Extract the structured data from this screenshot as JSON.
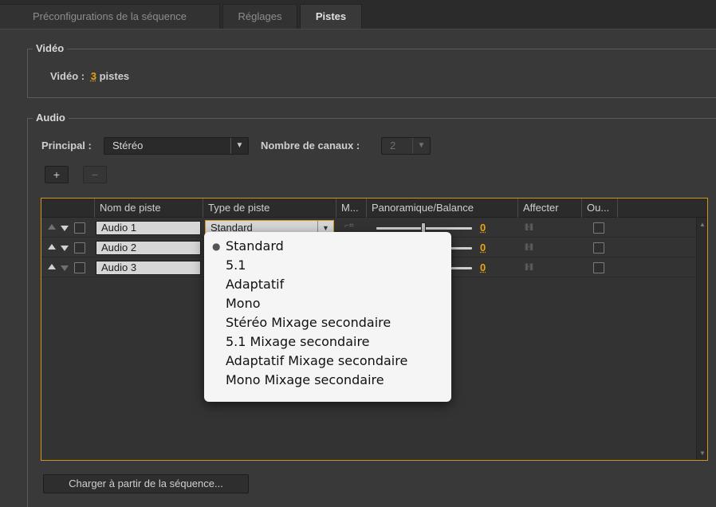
{
  "tabs": [
    {
      "label": "Préconfigurations de la séquence",
      "active": false
    },
    {
      "label": "Réglages",
      "active": false
    },
    {
      "label": "Pistes",
      "active": true
    }
  ],
  "video": {
    "group_title": "Vidéo",
    "label": "Vidéo :",
    "count": "3",
    "unit": "pistes"
  },
  "audio": {
    "group_title": "Audio",
    "principal_label": "Principal :",
    "principal_value": "Stéréo",
    "channels_label": "Nombre de canaux :",
    "channels_value": "2",
    "add_label": "+",
    "remove_label": "−"
  },
  "table": {
    "columns": [
      "Nom de piste",
      "Type de piste",
      "M...",
      "Panoramique/Balance",
      "Affecter",
      "Ou..."
    ],
    "rows": [
      {
        "name": "Audio 1",
        "type": "Standard",
        "pan": "0",
        "up_enabled": false,
        "down_enabled": true
      },
      {
        "name": "Audio 2",
        "type": "",
        "pan": "0",
        "up_enabled": true,
        "down_enabled": true
      },
      {
        "name": "Audio 3",
        "type": "",
        "pan": "0",
        "up_enabled": true,
        "down_enabled": false
      }
    ]
  },
  "dropdown": {
    "selected": "Standard",
    "options": [
      "Standard",
      "5.1",
      "Adaptatif",
      "Mono",
      "Stéréo Mixage secondaire",
      "5.1 Mixage secondaire",
      "Adaptatif Mixage secondaire",
      "Mono Mixage secondaire"
    ]
  },
  "load_button": "Charger à partir de la séquence...",
  "colors": {
    "accent": "#e8a415",
    "focus_border": "#d4941c",
    "background": "#393939"
  }
}
